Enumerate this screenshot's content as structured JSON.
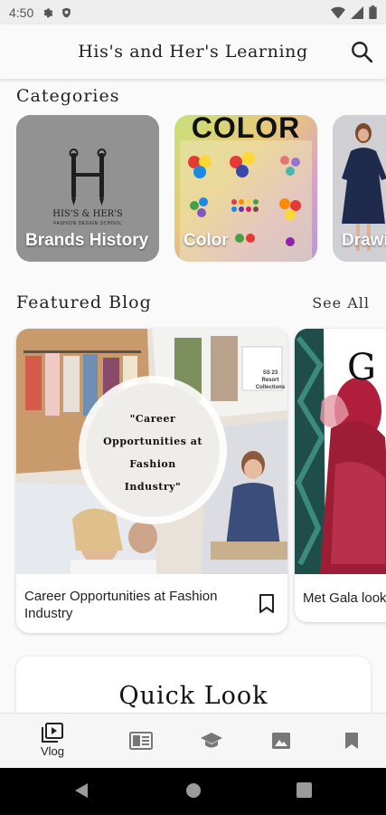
{
  "status_bar": {
    "time": "4:50"
  },
  "app_bar": {
    "title": "His's and Her's Learning"
  },
  "categories": {
    "title": "Categories",
    "items": [
      {
        "label": "Brands History",
        "logo_text": "HIS'S & HER'S",
        "logo_subtext": "FASHION DESIGN SCHOOL"
      },
      {
        "label": "Color",
        "poster_title": "COLOR"
      },
      {
        "label": "Drawi"
      }
    ]
  },
  "featured_blog": {
    "title": "Featured Blog",
    "see_all": "See All",
    "posts": [
      {
        "overlay_text": "\"Career Opportunities at Fashion Industry\"",
        "caption": "Career Opportunities at Fashion Industry",
        "badge": "SS 23 Resort Collections"
      },
      {
        "poster_text": "G",
        "caption": "Met Gala look"
      }
    ]
  },
  "quick_look": {
    "title": "Quick Look"
  },
  "bottom_nav": {
    "items": [
      {
        "label": "Vlog",
        "icon": "video-library-icon",
        "active": true
      },
      {
        "label": "",
        "icon": "article-icon"
      },
      {
        "label": "",
        "icon": "school-icon"
      },
      {
        "label": "",
        "icon": "image-icon"
      },
      {
        "label": "",
        "icon": "bookmark-icon"
      }
    ]
  },
  "colors": {
    "accent": "#222222",
    "card_bg": "#ffffff",
    "page_bg": "#fafafa",
    "nav_icon": "#777777"
  }
}
